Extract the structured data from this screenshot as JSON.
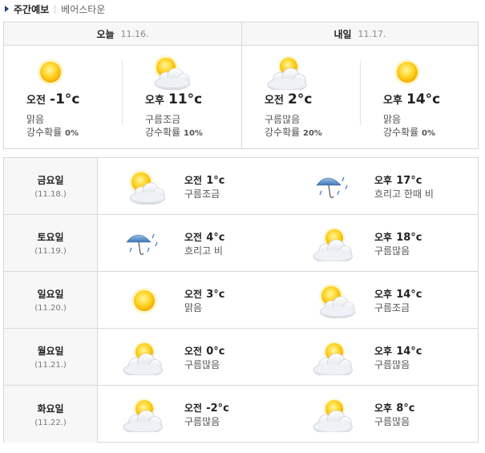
{
  "header": {
    "title": "주간예보",
    "location": "베어스타운"
  },
  "today": {
    "label": "오늘",
    "date": "11.16.",
    "am": {
      "period": "오전",
      "temp": "-1°c",
      "icon": "sunny-icon",
      "desc": "맑음",
      "rain_label": "강수확률",
      "rain": "0%"
    },
    "pm": {
      "period": "오후",
      "temp": "11°c",
      "icon": "partly-cloudy-icon",
      "desc": "구름조금",
      "rain_label": "강수확률",
      "rain": "10%"
    }
  },
  "tomorrow": {
    "label": "내일",
    "date": "11.17.",
    "am": {
      "period": "오전",
      "temp": "2°c",
      "icon": "mostly-cloudy-icon",
      "desc": "구름많음",
      "rain_label": "강수확률",
      "rain": "20%"
    },
    "pm": {
      "period": "오후",
      "temp": "14°c",
      "icon": "sunny-icon",
      "desc": "맑음",
      "rain_label": "강수확률",
      "rain": "0%"
    }
  },
  "week": [
    {
      "day": "금요일",
      "date": "(11.18.)",
      "am": {
        "period": "오전",
        "temp": "1°c",
        "icon": "partly-cloudy-icon",
        "desc": "구름조금"
      },
      "pm": {
        "period": "오후",
        "temp": "17°c",
        "icon": "rain-umbrella-icon",
        "desc": "흐리고 한때 비"
      }
    },
    {
      "day": "토요일",
      "date": "(11.19.)",
      "am": {
        "period": "오전",
        "temp": "4°c",
        "icon": "rain-umbrella-icon",
        "desc": "흐리고 비"
      },
      "pm": {
        "period": "오후",
        "temp": "18°c",
        "icon": "mostly-cloudy-icon",
        "desc": "구름많음"
      }
    },
    {
      "day": "일요일",
      "date": "(11.20.)",
      "am": {
        "period": "오전",
        "temp": "3°c",
        "icon": "sunny-icon",
        "desc": "맑음"
      },
      "pm": {
        "period": "오후",
        "temp": "14°c",
        "icon": "partly-cloudy-icon",
        "desc": "구름조금"
      }
    },
    {
      "day": "월요일",
      "date": "(11.21.)",
      "am": {
        "period": "오전",
        "temp": "0°c",
        "icon": "mostly-cloudy-icon",
        "desc": "구름많음"
      },
      "pm": {
        "period": "오후",
        "temp": "14°c",
        "icon": "mostly-cloudy-icon",
        "desc": "구름많음"
      }
    },
    {
      "day": "화요일",
      "date": "(11.22.)",
      "am": {
        "period": "오전",
        "temp": "-2°c",
        "icon": "mostly-cloudy-icon",
        "desc": "구름많음"
      },
      "pm": {
        "period": "오후",
        "temp": "8°c",
        "icon": "mostly-cloudy-icon",
        "desc": "구름많음"
      }
    }
  ]
}
